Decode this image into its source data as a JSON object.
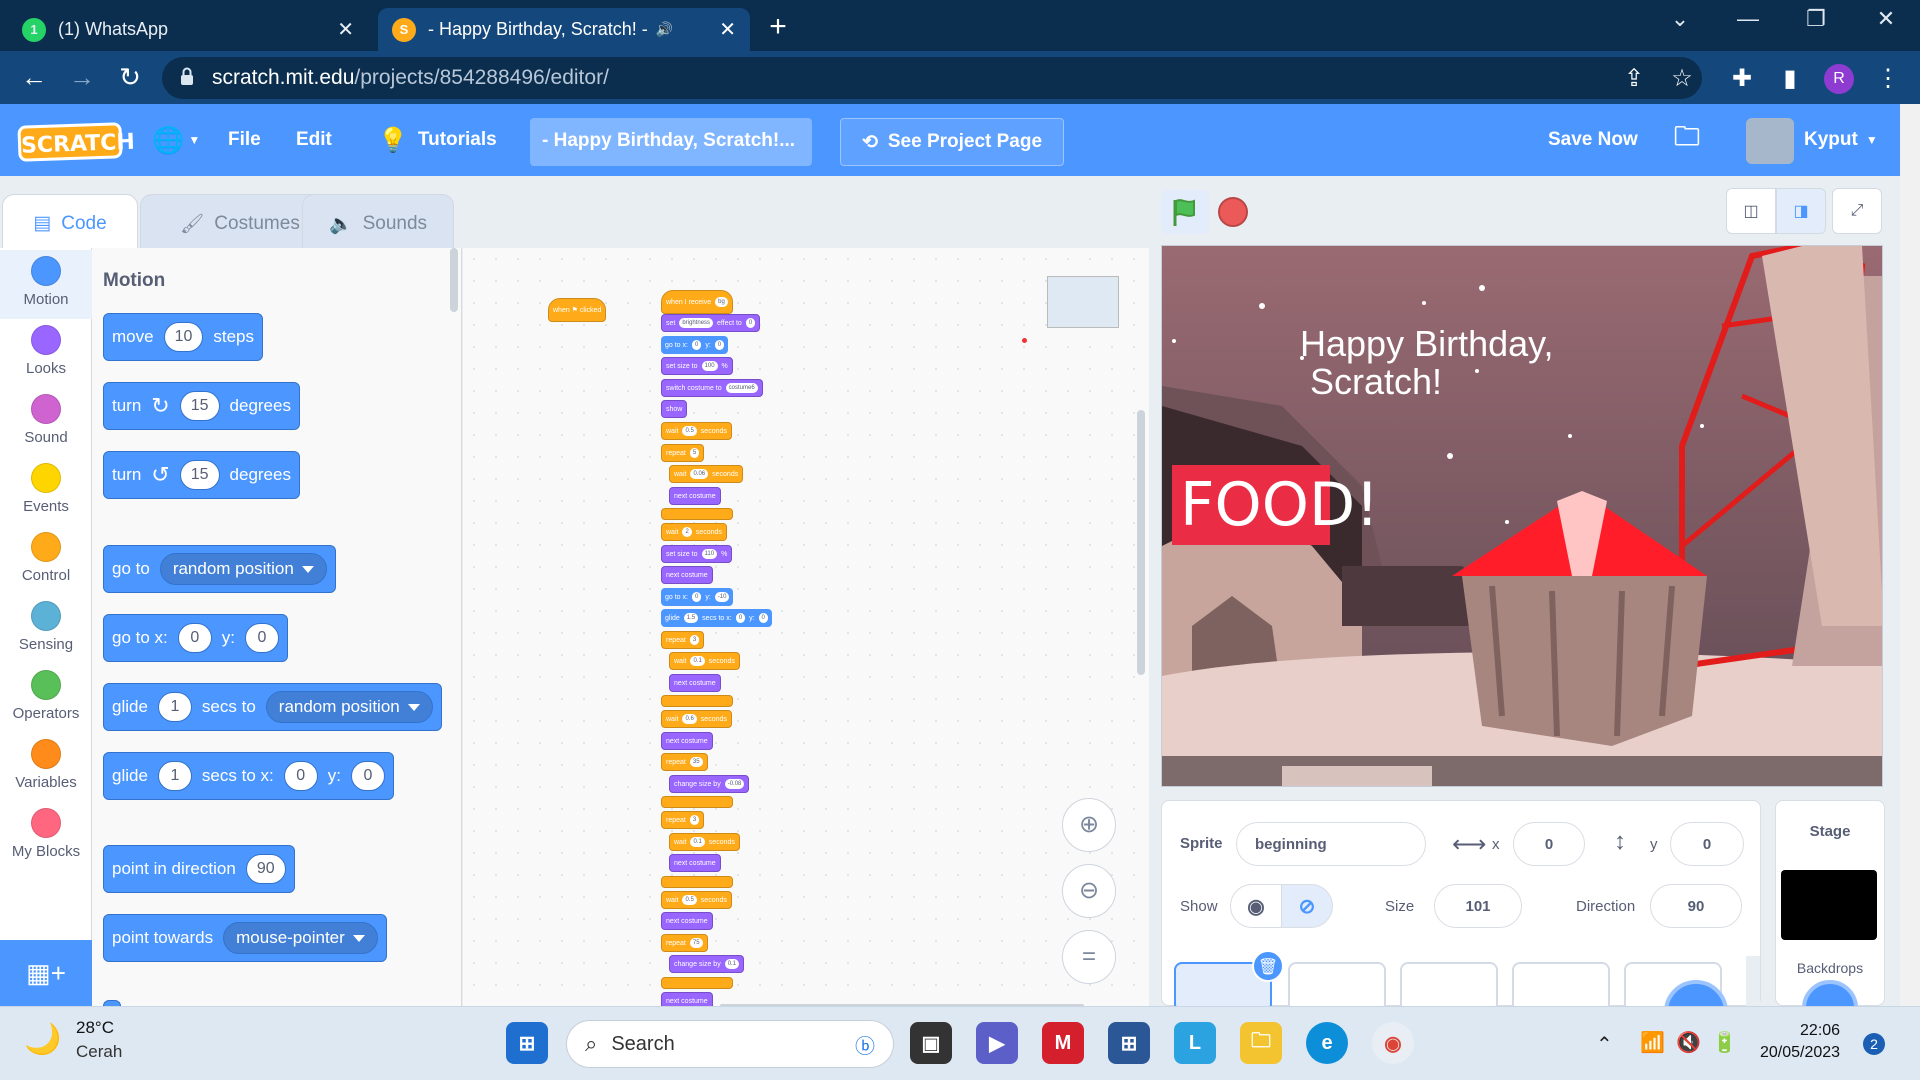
{
  "browser": {
    "tabs": [
      {
        "title": "(1) WhatsApp",
        "active": false,
        "icon": "whatsapp-icon"
      },
      {
        "title": "- Happy Birthday, Scratch! - ",
        "active": true,
        "icon": "scratch-cat-icon"
      }
    ],
    "url_host": "scratch.mit.edu",
    "url_path": "/projects/854288496/editor/",
    "profile_initial": "R"
  },
  "menubar": {
    "logo": "SCRATCH",
    "file": "File",
    "edit": "Edit",
    "tutorials": "Tutorials",
    "project_title": "- Happy Birthday, Scratch!...",
    "see_project_page": "See Project Page",
    "save_now": "Save Now",
    "username": "Kyput"
  },
  "tabs": {
    "code": "Code",
    "costumes": "Costumes",
    "sounds": "Sounds"
  },
  "categories": [
    {
      "label": "Motion",
      "color": "#4c97ff"
    },
    {
      "label": "Looks",
      "color": "#9966ff"
    },
    {
      "label": "Sound",
      "color": "#cf63cf"
    },
    {
      "label": "Events",
      "color": "#ffd500"
    },
    {
      "label": "Control",
      "color": "#ffab19"
    },
    {
      "label": "Sensing",
      "color": "#5cb1d6"
    },
    {
      "label": "Operators",
      "color": "#59c059"
    },
    {
      "label": "Variables",
      "color": "#ff8c1a"
    },
    {
      "label": "My Blocks",
      "color": "#ff6680"
    }
  ],
  "palette": {
    "header": "Motion",
    "move": {
      "a": "move",
      "v": "10",
      "b": "steps"
    },
    "turn_cw": {
      "a": "turn",
      "v": "15",
      "b": "degrees"
    },
    "turn_ccw": {
      "a": "turn",
      "v": "15",
      "b": "degrees"
    },
    "goto_random": {
      "a": "go to",
      "d": "random position"
    },
    "goto_xy": {
      "a": "go to x:",
      "x": "0",
      "b": "y:",
      "y": "0"
    },
    "glide_random": {
      "a": "glide",
      "v": "1",
      "b": "secs to",
      "d": "random position"
    },
    "glide_xy": {
      "a": "glide",
      "v": "1",
      "b": "secs to x:",
      "x": "0",
      "c": "y:",
      "y": "0"
    },
    "point_dir": {
      "a": "point in direction",
      "v": "90"
    },
    "point_towards": {
      "a": "point towards",
      "d": "mouse-pointer"
    }
  },
  "script": {
    "hat_flag": "when ⚑ clicked",
    "hat_receive": {
      "a": "when I receive",
      "v": "bg"
    },
    "set_effect": {
      "a": "set",
      "d": "brightness",
      "b": "effect to",
      "v": "0"
    },
    "goto": {
      "a": "go to x:",
      "x": "0",
      "b": "y:",
      "y": "0"
    },
    "set_size": {
      "a": "set size to",
      "v": "100",
      "b": "%"
    },
    "switch_costume": {
      "a": "switch costume to",
      "d": "costume6"
    },
    "show": "show",
    "wait1": {
      "a": "wait",
      "v": "0.5",
      "b": "seconds"
    },
    "repeat1": {
      "a": "repeat",
      "v": "5"
    },
    "wait2": {
      "a": "wait",
      "v": "0.06",
      "b": "seconds"
    },
    "next_costume": "next costume",
    "wait3": {
      "a": "wait",
      "v": "2",
      "b": "seconds"
    },
    "set_size2": {
      "a": "set size to",
      "v": "110",
      "b": "%"
    },
    "goto2": {
      "a": "go to x:",
      "x": "0",
      "b": "y:",
      "y": "-10"
    },
    "glide": {
      "a": "glide",
      "v": "1.5",
      "b": "secs to x:",
      "x": "0",
      "c": "y:",
      "y": "0"
    },
    "repeat2": {
      "a": "repeat",
      "v": "3"
    },
    "wait4": {
      "a": "wait",
      "v": "0.1",
      "b": "seconds"
    },
    "wait5": {
      "a": "wait",
      "v": "0.6",
      "b": "seconds"
    },
    "repeat3": {
      "a": "repeat",
      "v": "35"
    },
    "change_size1": {
      "a": "change size by",
      "v": "-0.08"
    },
    "repeat4": {
      "a": "repeat",
      "v": "3"
    },
    "wait6": {
      "a": "wait",
      "v": "0.1",
      "b": "seconds"
    },
    "wait7": {
      "a": "wait",
      "v": "0.5",
      "b": "seconds"
    },
    "repeat5": {
      "a": "repeat",
      "v": "75"
    },
    "change_size2": {
      "a": "change size by",
      "v": "0.1"
    }
  },
  "stage": {
    "title_line1": "Happy Birthday,",
    "title_line2": "Scratch!",
    "food_sign": "FOOD!"
  },
  "sprite_info": {
    "sprite_label": "Sprite",
    "sprite_name": "beginning",
    "x_label": "x",
    "x": "0",
    "y_label": "y",
    "y": "0",
    "show_label": "Show",
    "size_label": "Size",
    "size": "101",
    "direction_label": "Direction",
    "direction": "90"
  },
  "stage_panel": {
    "label": "Stage",
    "backdrops": "Backdrops"
  },
  "taskbar": {
    "temp": "28°C",
    "weather": "Cerah",
    "search": "Search",
    "time": "22:06",
    "date": "20/05/2023",
    "notifications": "2"
  }
}
